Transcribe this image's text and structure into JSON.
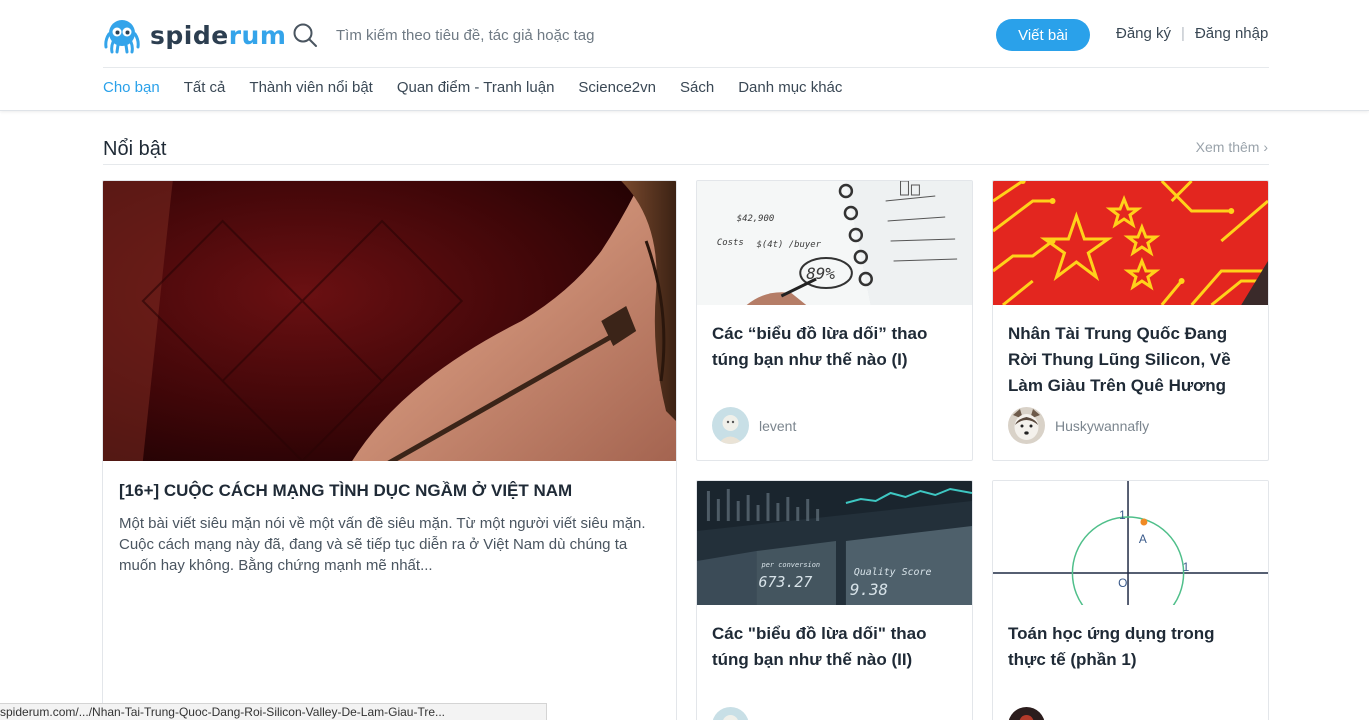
{
  "brand": {
    "name_part1": "spide",
    "name_part2": "rum"
  },
  "search": {
    "placeholder": "Tìm kiếm theo tiêu đề, tác giả hoặc tag"
  },
  "header": {
    "write_label": "Viết bài",
    "register_label": "Đăng ký",
    "login_label": "Đăng nhập",
    "separator": "|"
  },
  "nav": {
    "items": [
      {
        "label": "Cho bạn",
        "active": true
      },
      {
        "label": "Tất cả"
      },
      {
        "label": "Thành viên nổi bật"
      },
      {
        "label": "Quan điểm - Tranh luận"
      },
      {
        "label": "Science2vn"
      },
      {
        "label": "Sách"
      },
      {
        "label": "Danh mục khác"
      }
    ]
  },
  "featured": {
    "title": "Nổi bật",
    "see_more": "Xem thêm ›",
    "main": {
      "title": "[16+] CUỘC CÁCH MẠNG TÌNH DỤC NGẦM Ở VIỆT NAM",
      "excerpt": "Một bài viết siêu mặn nói về một vấn đề siêu mặn. Từ một người viết siêu mặn. Cuộc cách mạng này đã, đang và sẽ tiếp tục diễn ra ở Việt Nam dù chúng ta muốn hay không. Bằng chứng mạnh mẽ nhất..."
    },
    "cards": [
      {
        "title": "Các “biểu đồ lừa dối” thao túng bạn như thế nào (I)",
        "author": "levent"
      },
      {
        "title": "Nhân Tài Trung Quốc Đang Rời Thung Lũng Silicon, Về Làm Giàu Trên Quê Hương",
        "author": "Huskywannafly"
      },
      {
        "title": "Các \"biểu đồ lừa dối\" thao túng bạn như thế nào (II)",
        "author": ""
      },
      {
        "title": "Toán học ứng dụng trong thực tế (phần 1)",
        "author": ""
      }
    ],
    "chart_thumb": {
      "text1": "Quality Score",
      "text2": "9.38",
      "text3": "673.27",
      "text4": "per conversion"
    },
    "notebook_thumb": {
      "text1": "$42,900",
      "text2": "89%",
      "text3": "Costs",
      "text4": "$(4t) /buyer"
    },
    "math_thumb": {
      "label_a": "A",
      "label_o": "O",
      "label_1": "1",
      "label_1b": "1"
    }
  },
  "status": {
    "url": "spiderum.com/.../Nhan-Tai-Trung-Quoc-Dang-Roi-Silicon-Valley-De-Lam-Giau-Tre..."
  },
  "colors": {
    "accent": "#2aa1ea",
    "brand_dark": "#2c3e50"
  }
}
